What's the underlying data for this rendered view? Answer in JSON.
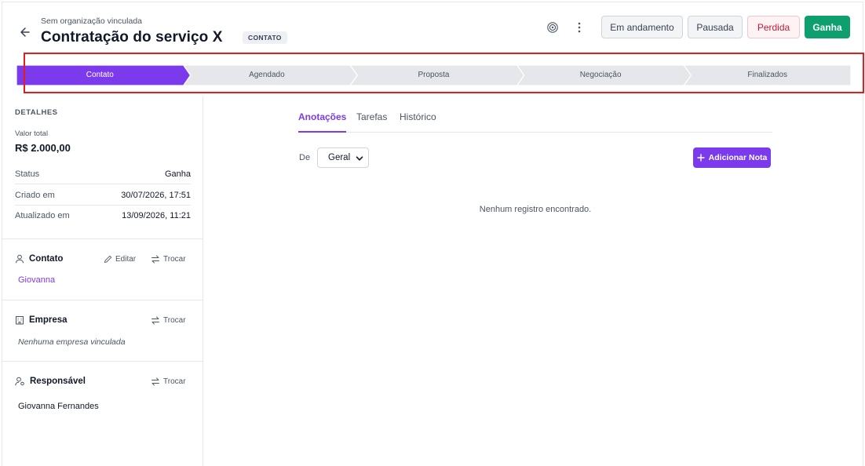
{
  "header": {
    "organization": "Sem organização vinculada",
    "title": "Contratação do serviço X",
    "stage_badge": "CONTATO",
    "buttons": {
      "em_andamento": "Em andamento",
      "pausada": "Pausada",
      "perdida": "Perdida",
      "ganha": "Ganha"
    }
  },
  "pipeline": {
    "active_color": "#7c3aed",
    "inactive_color": "#e5e7eb",
    "stages": [
      {
        "label": "Contato",
        "active": true
      },
      {
        "label": "Agendado",
        "active": false
      },
      {
        "label": "Proposta",
        "active": false
      },
      {
        "label": "Negociação",
        "active": false
      },
      {
        "label": "Finalizados",
        "active": false
      }
    ]
  },
  "sidebar": {
    "details_title": "DETALHES",
    "valor_label": "Valor total",
    "valor_value": "R$ 2.000,00",
    "rows": [
      {
        "key": "Status",
        "value": "Ganha"
      },
      {
        "key": "Criado em",
        "value": "30/07/2026, 17:51"
      },
      {
        "key": "Atualizado em",
        "value": "13/09/2026, 11:21"
      }
    ],
    "contato": {
      "title": "Contato",
      "edit_label": "Editar",
      "swap_label": "Trocar",
      "name": "Giovanna"
    },
    "empresa": {
      "title": "Empresa",
      "swap_label": "Trocar",
      "empty": "Nenhuma empresa vinculada"
    },
    "responsavel": {
      "title": "Responsável",
      "swap_label": "Trocar",
      "name": "Giovanna Fernandes"
    }
  },
  "main": {
    "tabs": [
      {
        "label": "Anotações",
        "active": true
      },
      {
        "label": "Tarefas",
        "active": false
      },
      {
        "label": "Histórico",
        "active": false
      }
    ],
    "filter_label": "De",
    "filter_value": "Geral",
    "add_note_label": "Adicionar Nota",
    "empty_message": "Nenhum registro encontrado."
  },
  "colors": {
    "accent": "#7c3aed",
    "success": "#0e9f6e",
    "danger": "#c21c3a",
    "highlight": "#e11d1d"
  }
}
